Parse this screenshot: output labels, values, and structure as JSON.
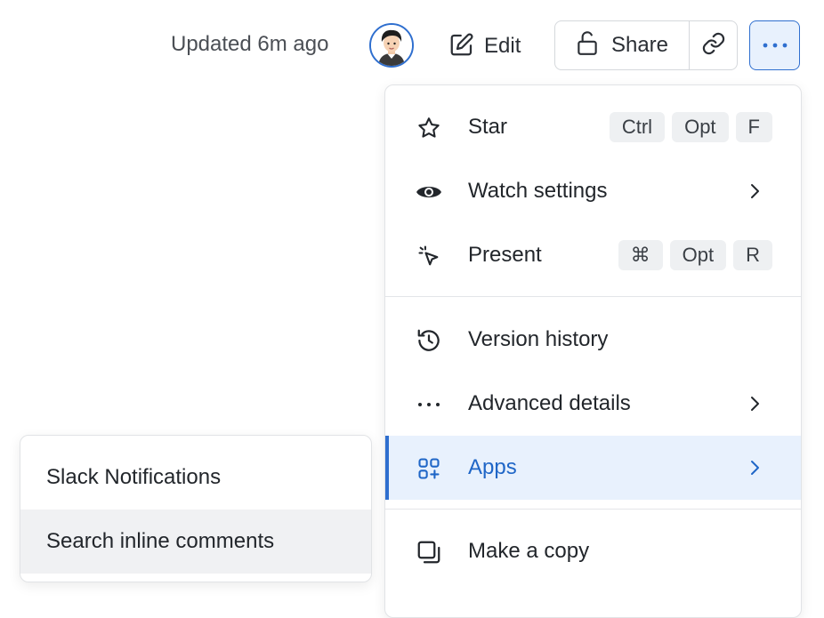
{
  "header": {
    "updated_text": "Updated 6m ago",
    "edit_label": "Edit",
    "share_label": "Share"
  },
  "menu": {
    "items": [
      {
        "label": "Star",
        "icon": "star-icon",
        "shortcut": [
          "Ctrl",
          "Opt",
          "F"
        ]
      },
      {
        "label": "Watch settings",
        "icon": "eye-icon",
        "has_submenu": true
      },
      {
        "label": "Present",
        "icon": "present-pointer-icon",
        "shortcut": [
          "⌘",
          "Opt",
          "R"
        ]
      },
      {
        "label": "Version history",
        "icon": "history-icon"
      },
      {
        "label": "Advanced details",
        "icon": "more-dots-icon",
        "has_submenu": true
      },
      {
        "label": "Apps",
        "icon": "apps-icon",
        "has_submenu": true,
        "active": true
      },
      {
        "label": "Make a copy",
        "icon": "copy-icon"
      }
    ]
  },
  "apps_submenu": {
    "items": [
      {
        "label": "Slack Notifications"
      },
      {
        "label": "Search inline comments",
        "hovered": true
      }
    ]
  },
  "colors": {
    "accent": "#2f6fcf",
    "active_bg": "#e8f1fd",
    "active_text": "#1f66c7",
    "hover_bg": "#f0f1f3"
  }
}
